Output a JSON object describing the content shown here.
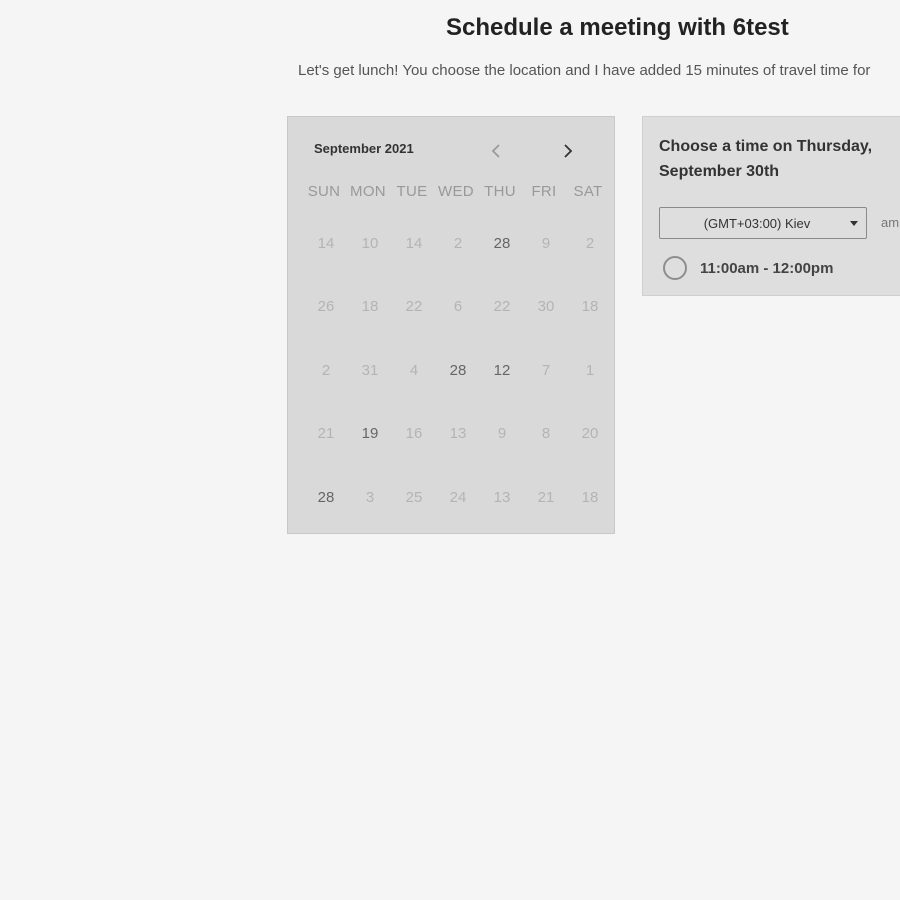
{
  "header": {
    "title": "Schedule a meeting with 6test",
    "subtitle": "Let's get lunch! You choose the location and I have added 15 minutes of travel time for"
  },
  "calendar": {
    "month_label": "September 2021",
    "prev_icon": "chevron-left-icon",
    "next_icon": "chevron-right-icon",
    "weekdays": [
      "SUN",
      "MON",
      "TUE",
      "WED",
      "THU",
      "FRI",
      "SAT"
    ],
    "weeks": [
      [
        {
          "d": "14",
          "a": false
        },
        {
          "d": "10",
          "a": false
        },
        {
          "d": "14",
          "a": false
        },
        {
          "d": "2",
          "a": false
        },
        {
          "d": "28",
          "a": true
        },
        {
          "d": "9",
          "a": false
        },
        {
          "d": "2",
          "a": false
        }
      ],
      [
        {
          "d": "26",
          "a": false
        },
        {
          "d": "18",
          "a": false
        },
        {
          "d": "22",
          "a": false
        },
        {
          "d": "6",
          "a": false
        },
        {
          "d": "22",
          "a": false
        },
        {
          "d": "30",
          "a": false
        },
        {
          "d": "18",
          "a": false
        }
      ],
      [
        {
          "d": "2",
          "a": false
        },
        {
          "d": "31",
          "a": false
        },
        {
          "d": "4",
          "a": false
        },
        {
          "d": "28",
          "a": true
        },
        {
          "d": "12",
          "a": true
        },
        {
          "d": "7",
          "a": false
        },
        {
          "d": "1",
          "a": false
        }
      ],
      [
        {
          "d": "21",
          "a": false
        },
        {
          "d": "19",
          "a": true
        },
        {
          "d": "16",
          "a": false
        },
        {
          "d": "13",
          "a": false
        },
        {
          "d": "9",
          "a": false
        },
        {
          "d": "8",
          "a": false
        },
        {
          "d": "20",
          "a": false
        }
      ],
      [
        {
          "d": "28",
          "a": true
        },
        {
          "d": "3",
          "a": false
        },
        {
          "d": "25",
          "a": false
        },
        {
          "d": "24",
          "a": false
        },
        {
          "d": "13",
          "a": false
        },
        {
          "d": "21",
          "a": false
        },
        {
          "d": "18",
          "a": false
        }
      ]
    ]
  },
  "time_panel": {
    "title_line1": "Choose a time on Thursday,",
    "title_line2": "September 30th",
    "timezone": "(GMT+03:00) Kiev",
    "ampm_label": "am",
    "slots": [
      {
        "label": "11:00am - 12:00pm"
      }
    ]
  }
}
